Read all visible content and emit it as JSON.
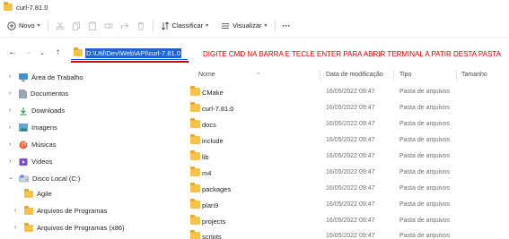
{
  "window": {
    "title": "curl-7.81.0"
  },
  "toolbar": {
    "new_label": "Novo",
    "sort_label": "Classificar",
    "view_label": "Visualizar",
    "more_label": "···"
  },
  "address": {
    "path": "D:\\Util\\Dev\\Web\\API\\curl-7.81.0"
  },
  "annotation": "DIGITE CMD NA BARRA E TECLE ENTER PARA ABRIR TERMINAL A PATIR DESTA PASTA",
  "sidebar": {
    "items": [
      {
        "label": "Área de Trabalho"
      },
      {
        "label": "Documentos"
      },
      {
        "label": "Downloads"
      },
      {
        "label": "Imagens"
      },
      {
        "label": "Músicas"
      },
      {
        "label": "Vídeos"
      },
      {
        "label": "Disco Local (C:)"
      },
      {
        "label": "Agile"
      },
      {
        "label": "Arquivos de Programas"
      },
      {
        "label": "Arquivos de Programas (x86)"
      }
    ]
  },
  "columns": {
    "name": "Nome",
    "date": "Data de modificação",
    "type": "Tipo",
    "size": "Tamanho"
  },
  "files": [
    {
      "name": "CMake",
      "date": "16/05/2022 09:47",
      "type": "Pasta de arquivos"
    },
    {
      "name": "curl-7.81.0",
      "date": "16/05/2022 09:47",
      "type": "Pasta de arquivos"
    },
    {
      "name": "docs",
      "date": "16/05/2022 09:47",
      "type": "Pasta de arquivos"
    },
    {
      "name": "include",
      "date": "16/05/2022 09:47",
      "type": "Pasta de arquivos"
    },
    {
      "name": "lib",
      "date": "16/05/2022 09:47",
      "type": "Pasta de arquivos"
    },
    {
      "name": "m4",
      "date": "16/05/2022 09:47",
      "type": "Pasta de arquivos"
    },
    {
      "name": "packages",
      "date": "16/05/2022 09:47",
      "type": "Pasta de arquivos"
    },
    {
      "name": "plan9",
      "date": "16/05/2022 09:47",
      "type": "Pasta de arquivos"
    },
    {
      "name": "projects",
      "date": "16/05/2022 09:47",
      "type": "Pasta de arquivos"
    },
    {
      "name": "scripts",
      "date": "16/05/2022 09:47",
      "type": "Pasta de arquivos"
    }
  ]
}
